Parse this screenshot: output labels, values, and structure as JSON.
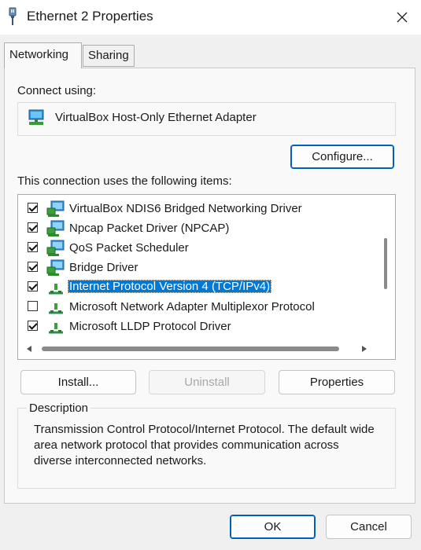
{
  "window": {
    "title": "Ethernet 2 Properties",
    "close_label": "✕"
  },
  "tabs": [
    {
      "label": "Networking"
    },
    {
      "label": "Sharing"
    }
  ],
  "connect_using": {
    "label": "Connect using:",
    "adapter": "VirtualBox Host-Only Ethernet Adapter"
  },
  "buttons": {
    "configure": "Configure...",
    "install": "Install...",
    "uninstall": "Uninstall",
    "properties": "Properties",
    "ok": "OK",
    "cancel": "Cancel"
  },
  "items_label": "This connection uses the following items:",
  "items": [
    {
      "label": "VirtualBox NDIS6 Bridged Networking Driver",
      "checked": true,
      "icon": "network-client-icon"
    },
    {
      "label": "Npcap Packet Driver (NPCAP)",
      "checked": true,
      "icon": "network-client-icon"
    },
    {
      "label": "QoS Packet Scheduler",
      "checked": true,
      "icon": "network-client-icon"
    },
    {
      "label": "Bridge Driver",
      "checked": true,
      "icon": "network-client-icon"
    },
    {
      "label": "Internet Protocol Version 4 (TCP/IPv4)",
      "checked": true,
      "icon": "protocol-icon",
      "selected": true
    },
    {
      "label": "Microsoft Network Adapter Multiplexor Protocol",
      "checked": false,
      "icon": "protocol-icon"
    },
    {
      "label": "Microsoft LLDP Protocol Driver",
      "checked": true,
      "icon": "protocol-icon"
    }
  ],
  "description": {
    "title": "Description",
    "text": "Transmission Control Protocol/Internet Protocol. The default wide area network protocol that provides communication across diverse interconnected networks."
  },
  "colors": {
    "accent": "#0078d7",
    "primary_border": "#005fb8"
  }
}
